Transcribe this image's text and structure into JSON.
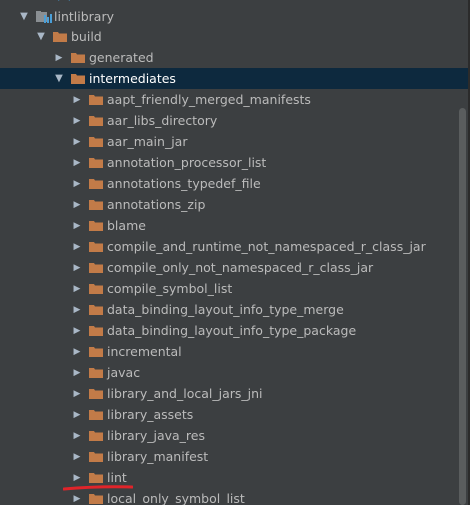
{
  "tree": {
    "root": {
      "label": "lintlibrary",
      "icon": "module-folder-icon"
    },
    "build": {
      "label": "build",
      "icon": "folder-icon"
    },
    "generated": {
      "label": "generated",
      "icon": "folder-icon"
    },
    "intermediates": {
      "label": "intermediates",
      "icon": "folder-icon"
    },
    "children": [
      {
        "label": "aapt_friendly_merged_manifests"
      },
      {
        "label": "aar_libs_directory"
      },
      {
        "label": "aar_main_jar"
      },
      {
        "label": "annotation_processor_list"
      },
      {
        "label": "annotations_typedef_file"
      },
      {
        "label": "annotations_zip"
      },
      {
        "label": "blame"
      },
      {
        "label": "compile_and_runtime_not_namespaced_r_class_jar"
      },
      {
        "label": "compile_only_not_namespaced_r_class_jar"
      },
      {
        "label": "compile_symbol_list"
      },
      {
        "label": "data_binding_layout_info_type_merge"
      },
      {
        "label": "data_binding_layout_info_type_package"
      },
      {
        "label": "incremental"
      },
      {
        "label": "javac"
      },
      {
        "label": "library_and_local_jars_jni"
      },
      {
        "label": "library_assets"
      },
      {
        "label": "library_java_res"
      },
      {
        "label": "library_manifest"
      },
      {
        "label": "lint"
      },
      {
        "label": "local_only_symbol_list"
      }
    ]
  },
  "colors": {
    "background": "#3c3f41",
    "selection": "#0d293e",
    "folder": "#c27b48",
    "text": "#bbbbbb",
    "annotation": "#e0242a"
  }
}
